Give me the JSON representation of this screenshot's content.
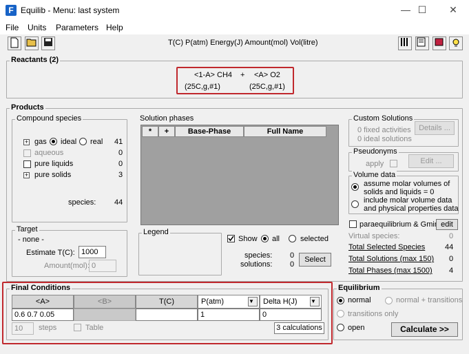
{
  "window": {
    "title": "Equilib - Menu: last system",
    "icon_letter": "F"
  },
  "window_controls": {
    "minimize": "—",
    "maximize": "☐",
    "close": "✕"
  },
  "menu": [
    "File",
    "Units",
    "Parameters",
    "Help"
  ],
  "toolbar": {
    "units_text": "T(C)  P(atm)  Energy(J)  Amount(mol)  Vol(litre)"
  },
  "reactants": {
    "title": "Reactants",
    "count": "(2)",
    "r1_top": "<1-A>  CH4",
    "plus": "+",
    "r2_top": "<A>  O2",
    "r1_bottom": "(25C,g,#1)",
    "r2_bottom": "(25C,g,#1)"
  },
  "products": {
    "title": "Products",
    "compound_species": {
      "title": "Compound species",
      "gas_label": "gas",
      "ideal_label": "ideal",
      "real_label": "real",
      "gas_count": "41",
      "aqueous_label": "aqueous",
      "aqueous_count": "0",
      "pure_liquids_label": "pure liquids",
      "pure_liquids_count": "0",
      "pure_solids_label": "pure solids",
      "pure_solids_count": "3",
      "species_label": "species:",
      "species_count": "44"
    },
    "target": {
      "title": "Target",
      "value": "- none -",
      "estimate_label": "Estimate T(C):",
      "estimate_value": "1000",
      "amount_label": "Amount(mol):",
      "amount_value": "0"
    },
    "solution_phases": {
      "title": "Solution phases",
      "col_star": "*",
      "col_plus": "+",
      "col_base": "Base-Phase",
      "col_full": "Full Name",
      "legend_title": "Legend",
      "show_label": "Show",
      "all_label": "all",
      "selected_label": "selected",
      "species_label": "species:",
      "species_count": "0",
      "solutions_label": "solutions:",
      "solutions_count": "0",
      "select_button": "Select"
    },
    "custom_solutions": {
      "title": "Custom Solutions",
      "fixed_activities": "0  fixed activities",
      "ideal_solutions": "0  ideal solutions",
      "details_button": "Details ..."
    },
    "pseudonyms": {
      "title": "Pseudonyms",
      "apply_label": "apply",
      "edit_button": "Edit ..."
    },
    "volume_data": {
      "title": "Volume data",
      "opt1_line1": "assume molar volumes of",
      "opt1_line2": "solids and liquids = 0",
      "opt2_line1": "include molar volume data",
      "opt2_line2": "and physical properties data"
    },
    "paraequilibrium_label": "paraequilibrium & Gmin",
    "edit_button": "edit",
    "virtual_species_label": "Virtual species:",
    "virtual_species_count": "0",
    "total_selected_label": "Total Selected Species",
    "total_selected_count": "44",
    "total_solutions_label": "Total Solutions (max 150)",
    "total_solutions_count": "0",
    "total_phases_label": "Total Phases (max 1500)",
    "total_phases_count": "4"
  },
  "final_conditions": {
    "title": "Final Conditions",
    "col_a": "<A>",
    "col_b": "<B>",
    "col_t": "T(C)",
    "col_p": "P(atm)",
    "col_dh": "Delta H(J)",
    "a_value": "0.6  0.7  0.05",
    "b_value": "",
    "t_value": "",
    "p_value": "1",
    "dh_value": "0",
    "steps_value": "10",
    "steps_label": "steps",
    "table_label": "Table",
    "calculations": "3 calculations"
  },
  "equilibrium": {
    "title": "Equilibrium",
    "normal": "normal",
    "normal_transitions": "normal + transitions",
    "transitions_only": "transitions only",
    "open": "open",
    "calculate_button": "Calculate >>"
  },
  "colors": {
    "highlight_red": "#c0282d",
    "grid_bg": "#a0a0a0",
    "window_bg": "#f0f0f0"
  }
}
